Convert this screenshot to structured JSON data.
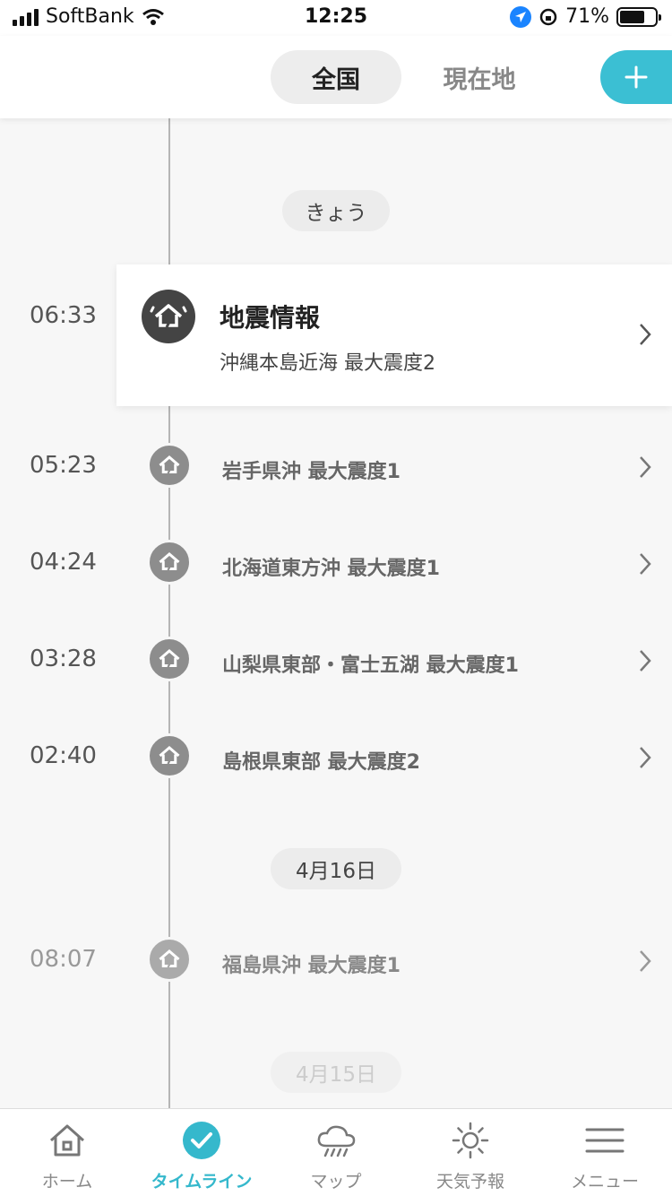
{
  "status": {
    "carrier": "SoftBank",
    "time": "12:25",
    "battery": "71%",
    "battery_level": 0.71
  },
  "tabs": {
    "nationwide": "全国",
    "current_location": "現在地"
  },
  "timeline": {
    "today_label": "きょう",
    "featured": {
      "time": "06:33",
      "title": "地震情報",
      "subtitle": "沖縄本島近海 最大震度2"
    },
    "items": [
      {
        "time": "05:23",
        "text": "岩手県沖 最大震度1"
      },
      {
        "time": "04:24",
        "text": "北海道東方沖 最大震度1"
      },
      {
        "time": "03:28",
        "text": "山梨県東部・富士五湖 最大震度1"
      },
      {
        "time": "02:40",
        "text": "島根県東部 最大震度2"
      }
    ],
    "date_apr16": "4月16日",
    "apr16_items": [
      {
        "time": "08:07",
        "text": "福島県沖 最大震度1"
      }
    ],
    "date_apr15": "4月15日"
  },
  "nav": {
    "home": "ホーム",
    "timeline": "タイムライン",
    "map": "マップ",
    "forecast": "天気予報",
    "menu": "メニュー"
  },
  "colors": {
    "accent": "#3bbfd3",
    "nav_active": "#35b8cc"
  }
}
